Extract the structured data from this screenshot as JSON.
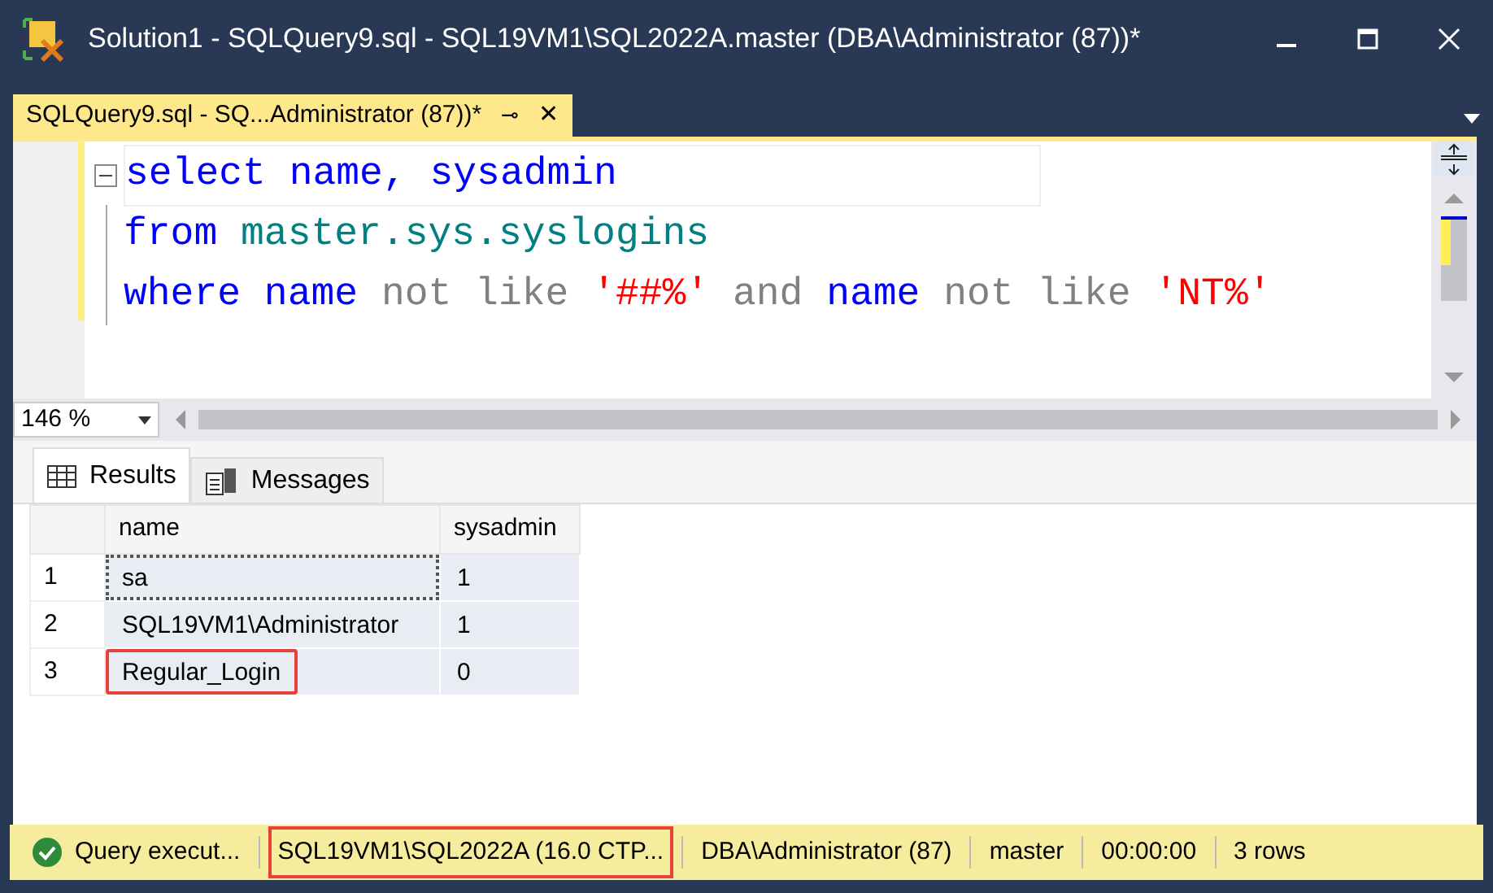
{
  "window": {
    "title": "Solution1 - SQLQuery9.sql - SQL19VM1\\SQL2022A.master (DBA\\Administrator (87))*"
  },
  "document_tab": {
    "label": "SQLQuery9.sql - SQ...Administrator (87))*",
    "pin": "⊸",
    "close": "✕"
  },
  "editor": {
    "lines": [
      [
        {
          "text": "select",
          "kind": "keyword"
        },
        {
          "text": " name, sysadmin",
          "kind": "identifier"
        }
      ],
      [
        {
          "text": "from",
          "kind": "keyword"
        },
        {
          "text": " master.sys.syslogins",
          "kind": "object"
        }
      ],
      [
        {
          "text": "where",
          "kind": "keyword"
        },
        {
          "text": " name ",
          "kind": "identifier"
        },
        {
          "text": "not like ",
          "kind": "operator"
        },
        {
          "text": "'##%'",
          "kind": "string"
        },
        {
          "text": " and ",
          "kind": "operator"
        },
        {
          "text": "name ",
          "kind": "identifier"
        },
        {
          "text": "not like ",
          "kind": "operator"
        },
        {
          "text": "'NT%'",
          "kind": "string"
        }
      ]
    ],
    "zoom": "146 %"
  },
  "result_tabs": [
    {
      "label": "Results",
      "selected": true
    },
    {
      "label": "Messages",
      "selected": false
    }
  ],
  "table": {
    "columns": [
      "name",
      "sysadmin"
    ],
    "rows": [
      {
        "number": "1",
        "cells": [
          {
            "text": "sa",
            "focused": true,
            "highlighted": false
          },
          {
            "text": "1",
            "focused": false,
            "highlighted": false
          }
        ]
      },
      {
        "number": "2",
        "cells": [
          {
            "text": "SQL19VM1\\Administrator",
            "focused": false,
            "highlighted": false
          },
          {
            "text": "1",
            "focused": false,
            "highlighted": false
          }
        ]
      },
      {
        "number": "3",
        "cells": [
          {
            "text": "Regular_Login",
            "focused": false,
            "highlighted": true
          },
          {
            "text": "0",
            "focused": false,
            "highlighted": false
          }
        ]
      }
    ]
  },
  "status_bar": [
    {
      "text": "Query execut...",
      "kind": "status",
      "highlighted": false
    },
    {
      "text": "SQL19VM1\\SQL2022A (16.0 CTP...",
      "kind": "text",
      "highlighted": true
    },
    {
      "text": "DBA\\Administrator (87)",
      "kind": "text",
      "highlighted": false
    },
    {
      "text": "master",
      "kind": "text",
      "highlighted": false
    },
    {
      "text": "00:00:00",
      "kind": "text",
      "highlighted": false
    },
    {
      "text": "3 rows",
      "kind": "text",
      "highlighted": false
    }
  ]
}
